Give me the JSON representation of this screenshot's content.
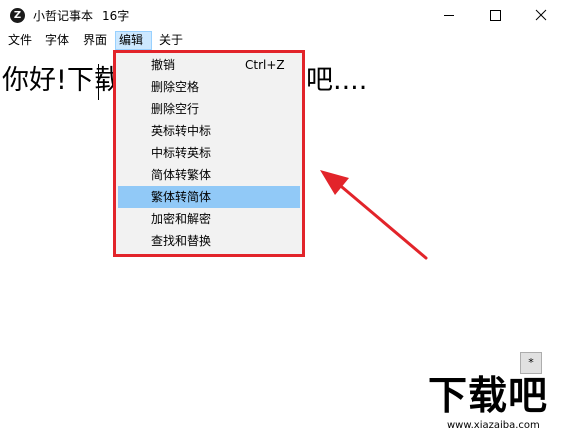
{
  "window": {
    "app_icon_letter": "Z",
    "title": "小哲记事本",
    "char_count": "16字"
  },
  "menubar": {
    "items": [
      "文件",
      "字体",
      "界面",
      "编辑",
      "关于"
    ],
    "active_index": 3
  },
  "editor": {
    "text_before_caret": "你好!下",
    "text_visible_fragment": "载",
    "text_tail": "吧...."
  },
  "dropdown": {
    "items": [
      {
        "label": "撤销",
        "shortcut": "Ctrl+Z"
      },
      {
        "label": "删除空格",
        "shortcut": ""
      },
      {
        "label": "删除空行",
        "shortcut": ""
      },
      {
        "label": "英标转中标",
        "shortcut": ""
      },
      {
        "label": "中标转英标",
        "shortcut": ""
      },
      {
        "label": "简体转繁体",
        "shortcut": ""
      },
      {
        "label": "繁体转简体",
        "shortcut": ""
      },
      {
        "label": "加密和解密",
        "shortcut": ""
      },
      {
        "label": "查找和替换",
        "shortcut": ""
      }
    ],
    "selected_index": 6
  },
  "star_button": {
    "label": "*"
  },
  "watermark": {
    "main": "下载吧",
    "url": "www.xiazaiba.com"
  },
  "colors": {
    "annotation_red": "#e2242a",
    "menu_selected": "#91c9f7",
    "menu_active_bg": "#cce8ff"
  }
}
